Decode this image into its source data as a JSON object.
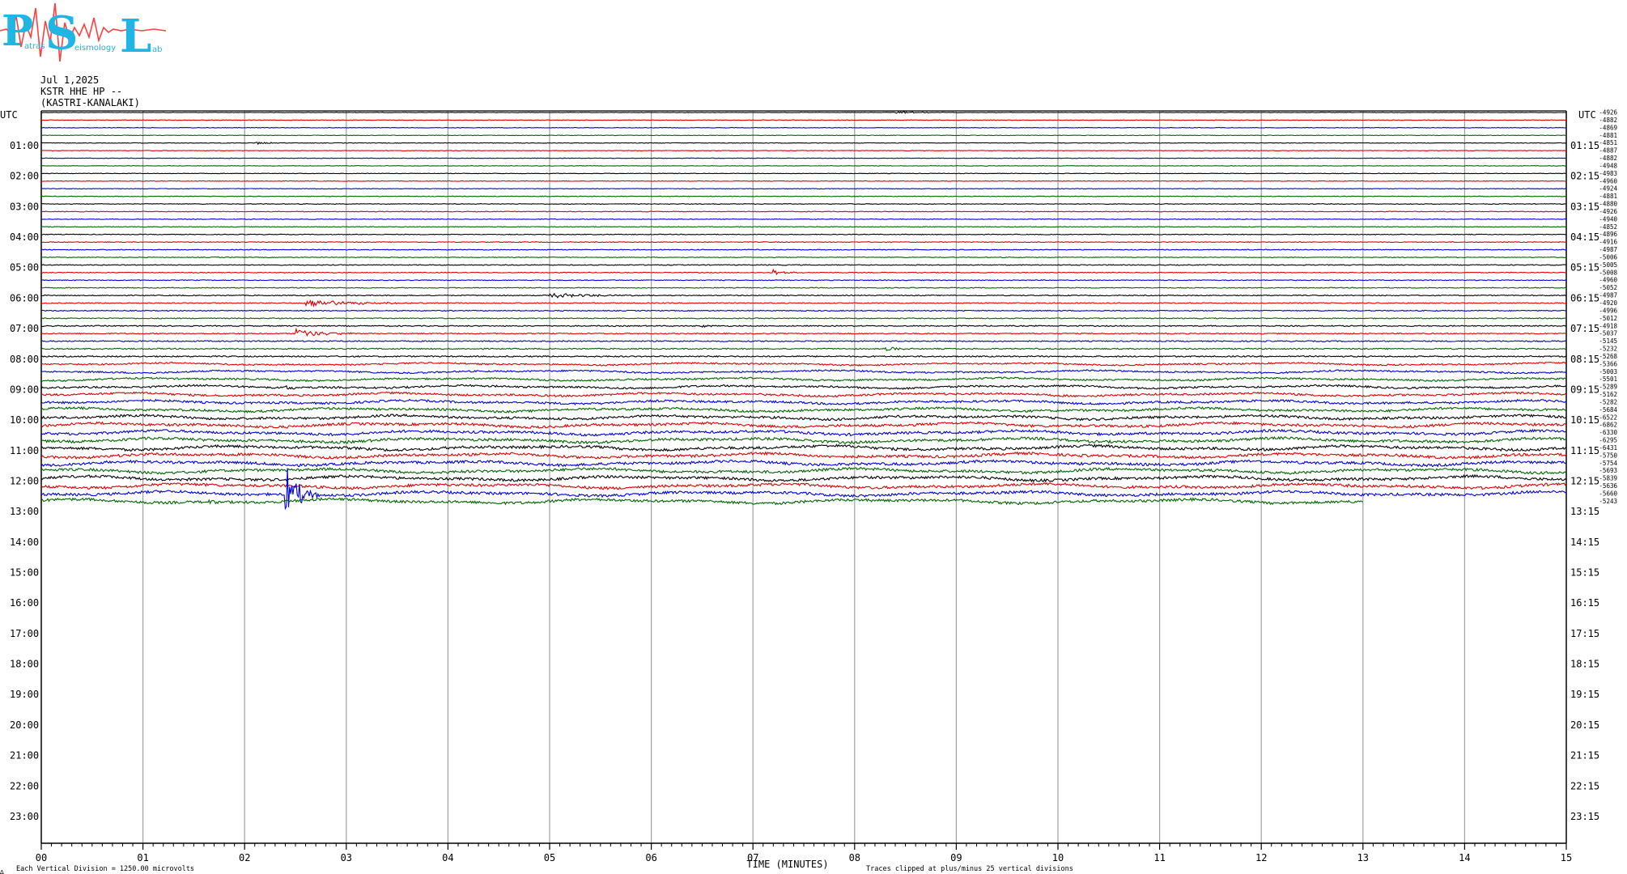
{
  "logo": {
    "letters": [
      "P",
      "S",
      "L"
    ],
    "small_words": [
      "atras",
      "eismology",
      "ab"
    ],
    "colors": {
      "letters": "#1fb6e4",
      "wave": "#ff4040"
    }
  },
  "header": {
    "date": "Jul 1,2025",
    "station": "KSTR HHE HP --",
    "location": "(KASTRI-KANALAKI)"
  },
  "chart_data": {
    "type": "line",
    "title": "Jul 1,2025",
    "xlabel": "TIME (MINUTES)",
    "left_axis_title": "UTC",
    "right_axis_title": "UTC",
    "x_ticks": [
      "00",
      "01",
      "02",
      "03",
      "04",
      "05",
      "06",
      "07",
      "08",
      "09",
      "10",
      "11",
      "12",
      "13",
      "14",
      "15"
    ],
    "xlim": [
      0,
      15
    ],
    "left_labels": [
      "01:00",
      "02:00",
      "03:00",
      "04:00",
      "05:00",
      "06:00",
      "07:00",
      "08:00",
      "09:00",
      "10:00",
      "11:00",
      "12:00",
      "13:00",
      "14:00",
      "15:00",
      "16:00",
      "17:00",
      "18:00",
      "19:00",
      "20:00",
      "21:00",
      "22:00",
      "23:00"
    ],
    "right_labels": [
      "01:15",
      "02:15",
      "03:15",
      "04:15",
      "05:15",
      "06:15",
      "07:15",
      "08:15",
      "09:15",
      "10:15",
      "11:15",
      "12:15",
      "13:15",
      "14:15",
      "15:15",
      "16:15",
      "17:15",
      "18:15",
      "19:15",
      "20:15",
      "21:15",
      "22:15",
      "23:15"
    ],
    "trace_colors": [
      "#000000",
      "#e00000",
      "#0000dd",
      "#006400"
    ],
    "trace_count": 52,
    "last_trace_end_minute": 13.0,
    "offsets": [
      -4926,
      -4882,
      -4869,
      -4881,
      -4851,
      -4887,
      -4882,
      -4948,
      -4983,
      -4960,
      -4924,
      -4881,
      -4880,
      -4926,
      -4940,
      -4852,
      -4896,
      -4916,
      -4987,
      -5006,
      -5005,
      -5008,
      -4960,
      -5052,
      -4987,
      -4920,
      -4996,
      -5012,
      -4918,
      -5037,
      -5145,
      -5232,
      -5268,
      -5366,
      -5003,
      -5501,
      -5289,
      -5162,
      -5282,
      -5684,
      -6522,
      -6862,
      -6330,
      -6295,
      -6431,
      -5750,
      -5754,
      -5693,
      -5839,
      -5636,
      -5660,
      -5243
    ],
    "noise_levels": [
      0.35,
      0.4,
      0.4,
      0.4,
      0.4,
      0.45,
      0.4,
      0.4,
      0.4,
      0.45,
      0.45,
      0.45,
      0.5,
      0.5,
      0.5,
      0.5,
      0.55,
      0.55,
      0.55,
      0.55,
      0.6,
      0.6,
      0.6,
      0.6,
      0.7,
      0.7,
      0.7,
      0.7,
      0.8,
      0.8,
      0.9,
      0.9,
      1.0,
      1.1,
      1.2,
      1.3,
      1.4,
      1.5,
      1.6,
      1.7,
      1.8,
      1.9,
      1.9,
      2.0,
      2.0,
      2.0,
      2.0,
      2.0,
      2.0,
      2.0,
      2.0,
      2.0
    ],
    "events": [
      {
        "trace": 0,
        "minute": 8.4,
        "amplitude": 2,
        "duration": 0.6
      },
      {
        "trace": 4,
        "minute": 2.1,
        "amplitude": 2,
        "duration": 0.3
      },
      {
        "trace": 21,
        "minute": 7.2,
        "amplitude": 4,
        "duration": 0.3
      },
      {
        "trace": 24,
        "minute": 5.0,
        "amplitude": 3,
        "duration": 1.2
      },
      {
        "trace": 25,
        "minute": 2.6,
        "amplitude": 5,
        "duration": 1.3
      },
      {
        "trace": 28,
        "minute": 6.5,
        "amplitude": 2,
        "duration": 0.2
      },
      {
        "trace": 29,
        "minute": 2.5,
        "amplitude": 6,
        "duration": 0.7
      },
      {
        "trace": 31,
        "minute": 8.3,
        "amplitude": 3,
        "duration": 0.3
      },
      {
        "trace": 36,
        "minute": 2.4,
        "amplitude": 3,
        "duration": 0.3
      },
      {
        "trace": 49,
        "minute": 13.1,
        "amplitude": 8,
        "duration": 0.05
      },
      {
        "trace": 50,
        "minute": 2.4,
        "amplitude": 40,
        "duration": 0.35
      },
      {
        "trace": 51,
        "minute": 1.65,
        "amplitude": 3,
        "duration": 0.1
      }
    ],
    "annotations": {
      "scale": "Each Vertical Division = 1250.00 microvolts",
      "clip": "Traces clipped at plus/minus 25 vertical divisions",
      "corner_mark": "∆"
    }
  }
}
